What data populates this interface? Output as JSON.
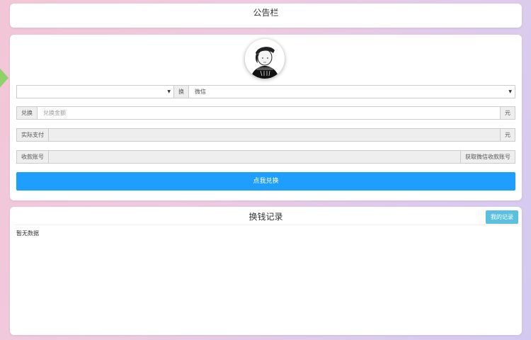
{
  "notice": {
    "title": "公告栏"
  },
  "form": {
    "source_select": {
      "value": ""
    },
    "swap_label": "换",
    "target_select": {
      "value": "微信"
    },
    "amount": {
      "label": "兑换",
      "placeholder": "兑换金额",
      "unit": "元"
    },
    "actual_pay": {
      "label": "实际支付",
      "value": "",
      "unit": "元"
    },
    "account": {
      "label": "收款账号",
      "value": "",
      "fetch_button": "获取微信收款账号"
    },
    "submit_label": "点我兑换"
  },
  "records": {
    "title": "换钱记录",
    "my_records_button": "我的记录",
    "empty_text": "暂无数据"
  },
  "colors": {
    "primary": "#1e9fff",
    "info": "#5bc0de",
    "accent_shape": "#8fd16a"
  },
  "icons": {
    "avatar": "avatar-image",
    "caret": "caret-down-icon"
  }
}
